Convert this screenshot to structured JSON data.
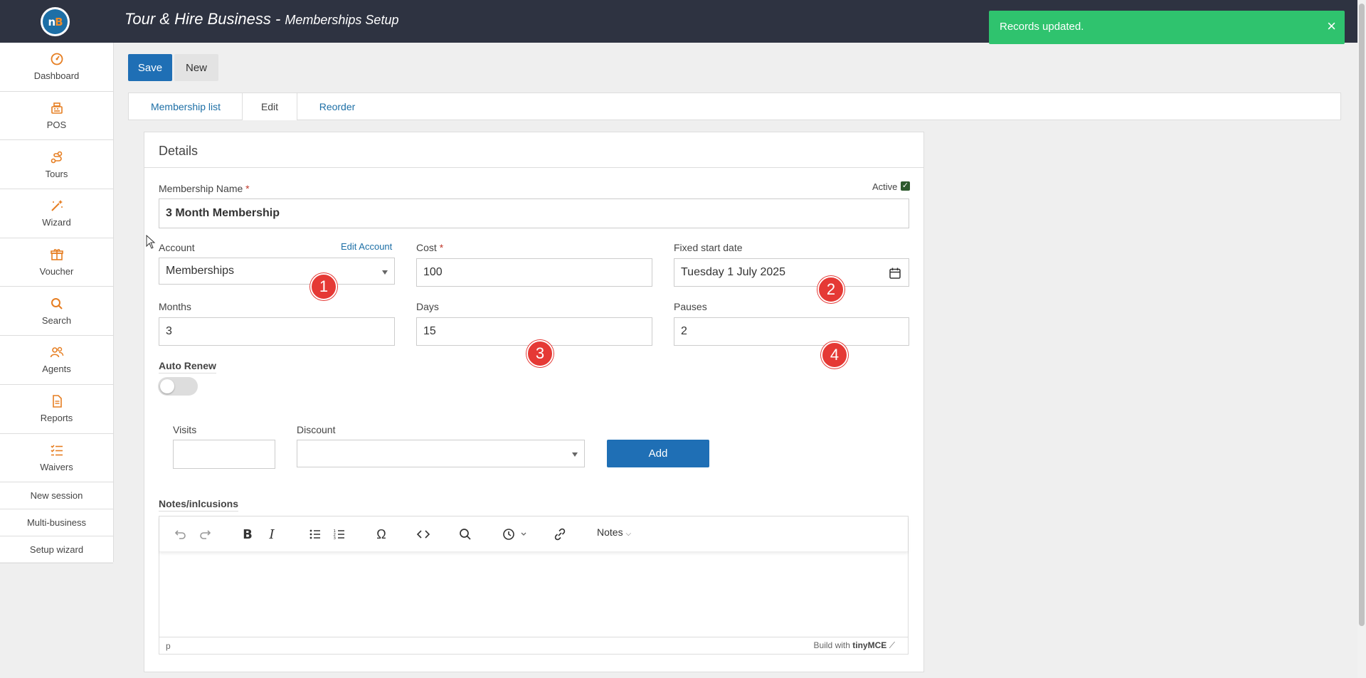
{
  "header": {
    "title_main": "Tour & Hire Business - ",
    "title_sub": "Memberships Setup",
    "logo_text": "nB"
  },
  "toast": {
    "message": "Records updated.",
    "close": "×"
  },
  "sidebar": {
    "items": [
      {
        "label": "Dashboard",
        "icon": "dashboard-icon"
      },
      {
        "label": "POS",
        "icon": "cash-register-icon"
      },
      {
        "label": "Tours",
        "icon": "route-icon"
      },
      {
        "label": "Wizard",
        "icon": "magic-wand-icon"
      },
      {
        "label": "Voucher",
        "icon": "gift-icon"
      },
      {
        "label": "Search",
        "icon": "search-icon"
      },
      {
        "label": "Agents",
        "icon": "users-icon"
      },
      {
        "label": "Reports",
        "icon": "document-icon"
      },
      {
        "label": "Waivers",
        "icon": "checklist-icon"
      }
    ],
    "links": [
      {
        "label": "New session"
      },
      {
        "label": "Multi-business"
      },
      {
        "label": "Setup wizard"
      }
    ]
  },
  "toolbar": {
    "save_label": "Save",
    "new_label": "New"
  },
  "tabs": [
    {
      "label": "Membership list"
    },
    {
      "label": "Edit"
    },
    {
      "label": "Reorder"
    }
  ],
  "details": {
    "title": "Details",
    "active_label": "Active",
    "active_checked": true,
    "membership_name_label": "Membership Name",
    "membership_name_value": "3 Month Membership",
    "account_label": "Account",
    "account_value": "Memberships",
    "edit_account_link": "Edit Account",
    "cost_label": "Cost",
    "cost_value": "100",
    "fixed_start_label": "Fixed start date",
    "fixed_start_value": "Tuesday 1 July 2025",
    "months_label": "Months",
    "months_value": "3",
    "days_label": "Days",
    "days_value": "15",
    "pauses_label": "Pauses",
    "pauses_value": "2",
    "auto_renew_label": "Auto Renew",
    "auto_renew_on": false,
    "visits_label": "Visits",
    "visits_value": "",
    "discount_label": "Discount",
    "discount_value": "",
    "add_label": "Add",
    "required_mark": "*"
  },
  "badges": [
    "1",
    "2",
    "3",
    "4"
  ],
  "notes": {
    "label": "Notes/inlcusions",
    "format_menu": "Notes",
    "status_path": "p",
    "built_with": "Build with",
    "brand": "tinyMCE"
  },
  "colors": {
    "topbar": "#2e3341",
    "primary": "#1f6fb5",
    "toast": "#2fc36e",
    "badge": "#e53935",
    "sidebar_icon": "#e67e22"
  }
}
